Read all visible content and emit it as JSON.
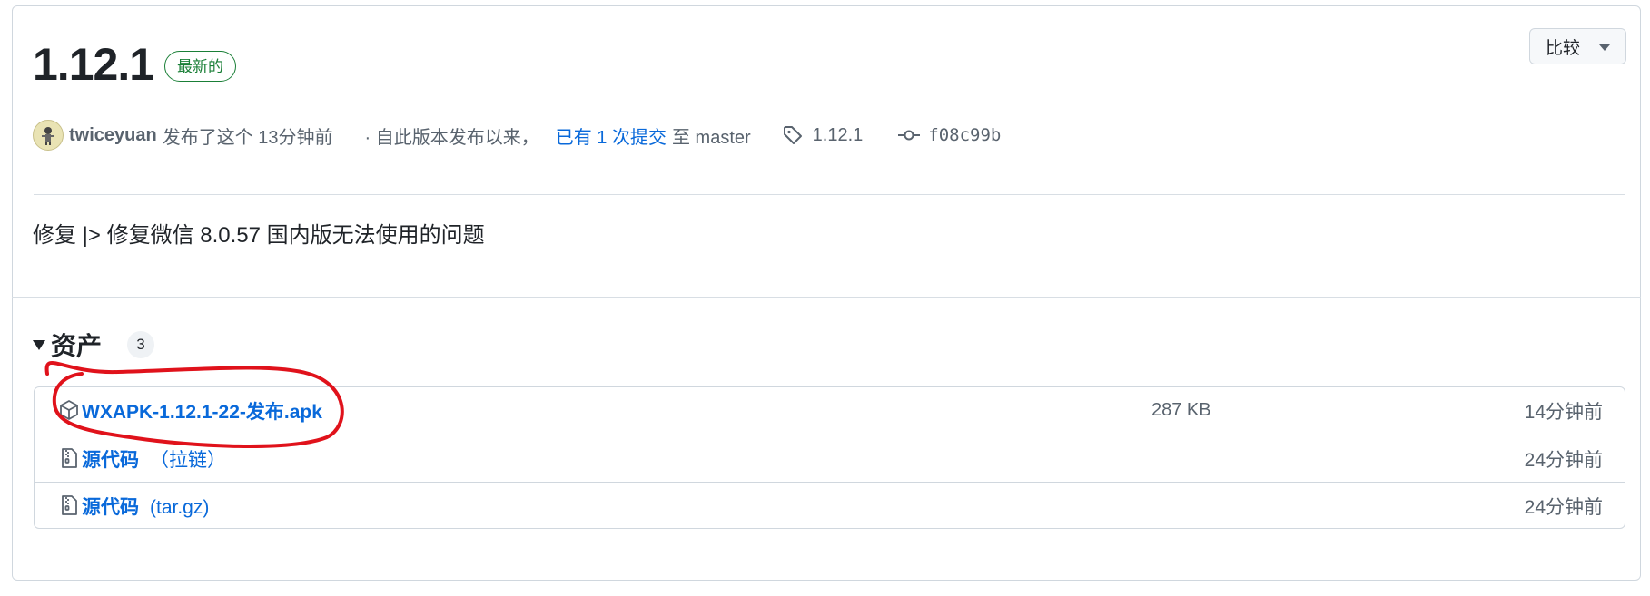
{
  "release": {
    "title": "1.12.1",
    "latest_badge": "最新的",
    "compare_label": "比较",
    "author": "twiceyuan",
    "published_text": "发布了这个 13分钟前",
    "since_text": "· 自此版本发布以来，",
    "commits_link": "已有 1 次提交",
    "to_text": "至 master",
    "tag": "1.12.1",
    "commit_sha": "f08c99b",
    "body": "修复 |> 修复微信 8.0.57 国内版无法使用的问题"
  },
  "assets": {
    "heading": "资产",
    "count": "3",
    "items": [
      {
        "name": "WXAPK-1.12.1-22-发布.apk",
        "sub": "",
        "size": "287 KB",
        "time": "14分钟前",
        "icon": "package-icon"
      },
      {
        "name": "源代码",
        "sub": "（拉链）",
        "size": "",
        "time": "24分钟前",
        "icon": "file-zip-icon"
      },
      {
        "name": "源代码",
        "sub": "(tar.gz)",
        "size": "",
        "time": "24分钟前",
        "icon": "file-zip-icon"
      }
    ]
  },
  "colors": {
    "link": "#0969da",
    "latest_badge": "#1a7f37",
    "annotation": "#e0121b"
  }
}
